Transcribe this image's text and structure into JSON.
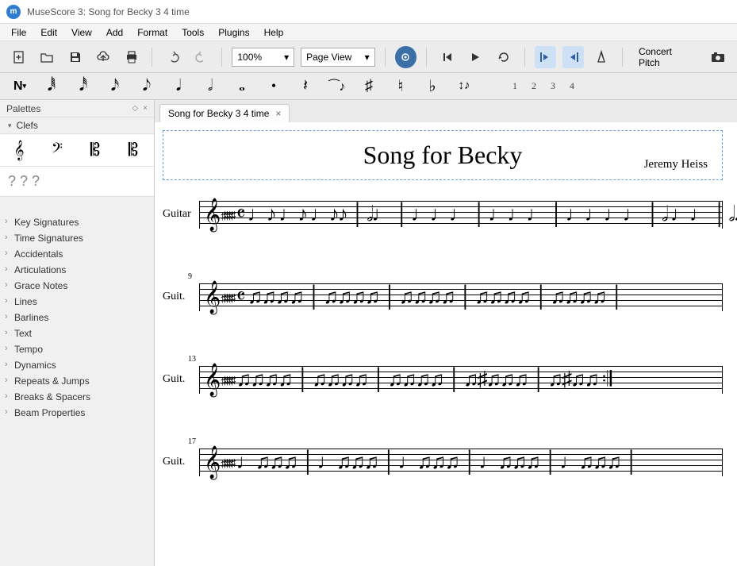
{
  "app": {
    "icon_letter": "m",
    "window_title": "MuseScore 3: Song for Becky 3 4 time"
  },
  "menu": [
    "File",
    "Edit",
    "View",
    "Add",
    "Format",
    "Tools",
    "Plugins",
    "Help"
  ],
  "toolbar": {
    "zoom": "100%",
    "view_mode": "Page View",
    "concert_pitch": "Concert Pitch"
  },
  "notebar": {
    "voices": [
      "1",
      "2",
      "3",
      "4"
    ]
  },
  "sidebar": {
    "title": "Palettes",
    "expanded_section": "Clefs",
    "unknown_row": "? ? ?",
    "items": [
      "Key Signatures",
      "Time Signatures",
      "Accidentals",
      "Articulations",
      "Grace Notes",
      "Lines",
      "Barlines",
      "Text",
      "Tempo",
      "Dynamics",
      "Repeats & Jumps",
      "Breaks & Spacers",
      "Beam Properties"
    ]
  },
  "tab": {
    "label": "Song for Becky 3 4 time"
  },
  "score": {
    "title": "Song for Becky",
    "composer": "Jeremy Heiss",
    "systems": [
      {
        "label": "Guitar",
        "bar_number": ""
      },
      {
        "label": "Guit.",
        "bar_number": "9"
      },
      {
        "label": "Guit.",
        "bar_number": "13"
      },
      {
        "label": "Guit.",
        "bar_number": "17"
      }
    ]
  }
}
